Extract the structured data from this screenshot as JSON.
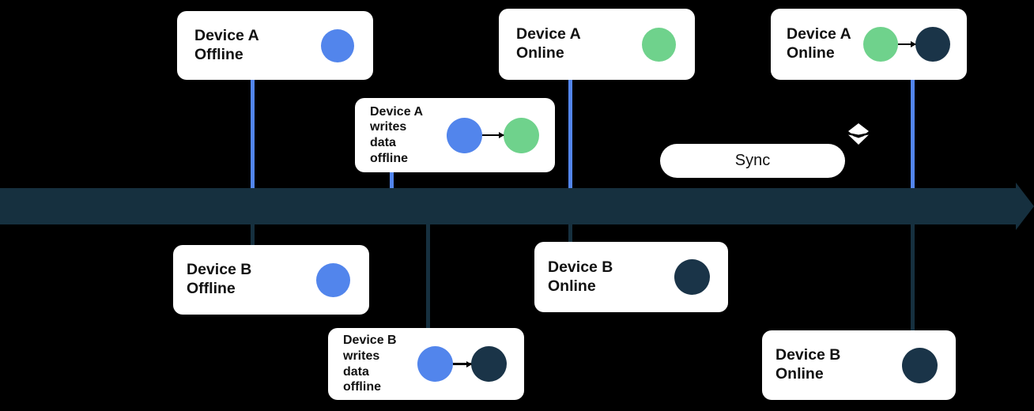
{
  "diagram": {
    "title": "Offline data sync timeline between two devices",
    "colors": {
      "background": "#000000",
      "card": "#FFFFFF",
      "timeline": "#16303F",
      "blue": "#5285EC",
      "green": "#6FD28C",
      "navy": "#1A3448",
      "text": "#111111"
    },
    "timeline": {
      "name": "time-axis",
      "direction": "left-to-right"
    },
    "sync": {
      "label": "Sync",
      "icon": "layers-icon"
    },
    "cards": {
      "device_a_offline": {
        "label": "Device A\nOffline",
        "dots": [
          "blue"
        ]
      },
      "device_a_writes_offline": {
        "label": "Device A\nwrites\ndata\noffline",
        "dots": [
          "blue",
          "green"
        ],
        "arrow": true
      },
      "device_a_online": {
        "label": "Device A\nOnline",
        "dots": [
          "green"
        ]
      },
      "device_a_online_synced": {
        "label": "Device A\nOnline",
        "dots": [
          "green",
          "navy"
        ],
        "arrow": true
      },
      "device_b_offline": {
        "label": "Device B\nOffline",
        "dots": [
          "blue"
        ]
      },
      "device_b_writes_offline": {
        "label": "Device B\nwrites\ndata\noffline",
        "dots": [
          "blue",
          "navy"
        ],
        "arrow": true
      },
      "device_b_online": {
        "label": "Device B\nOnline",
        "dots": [
          "navy"
        ]
      },
      "device_b_online_synced": {
        "label": "Device B\nOnline",
        "dots": [
          "navy"
        ]
      }
    }
  }
}
